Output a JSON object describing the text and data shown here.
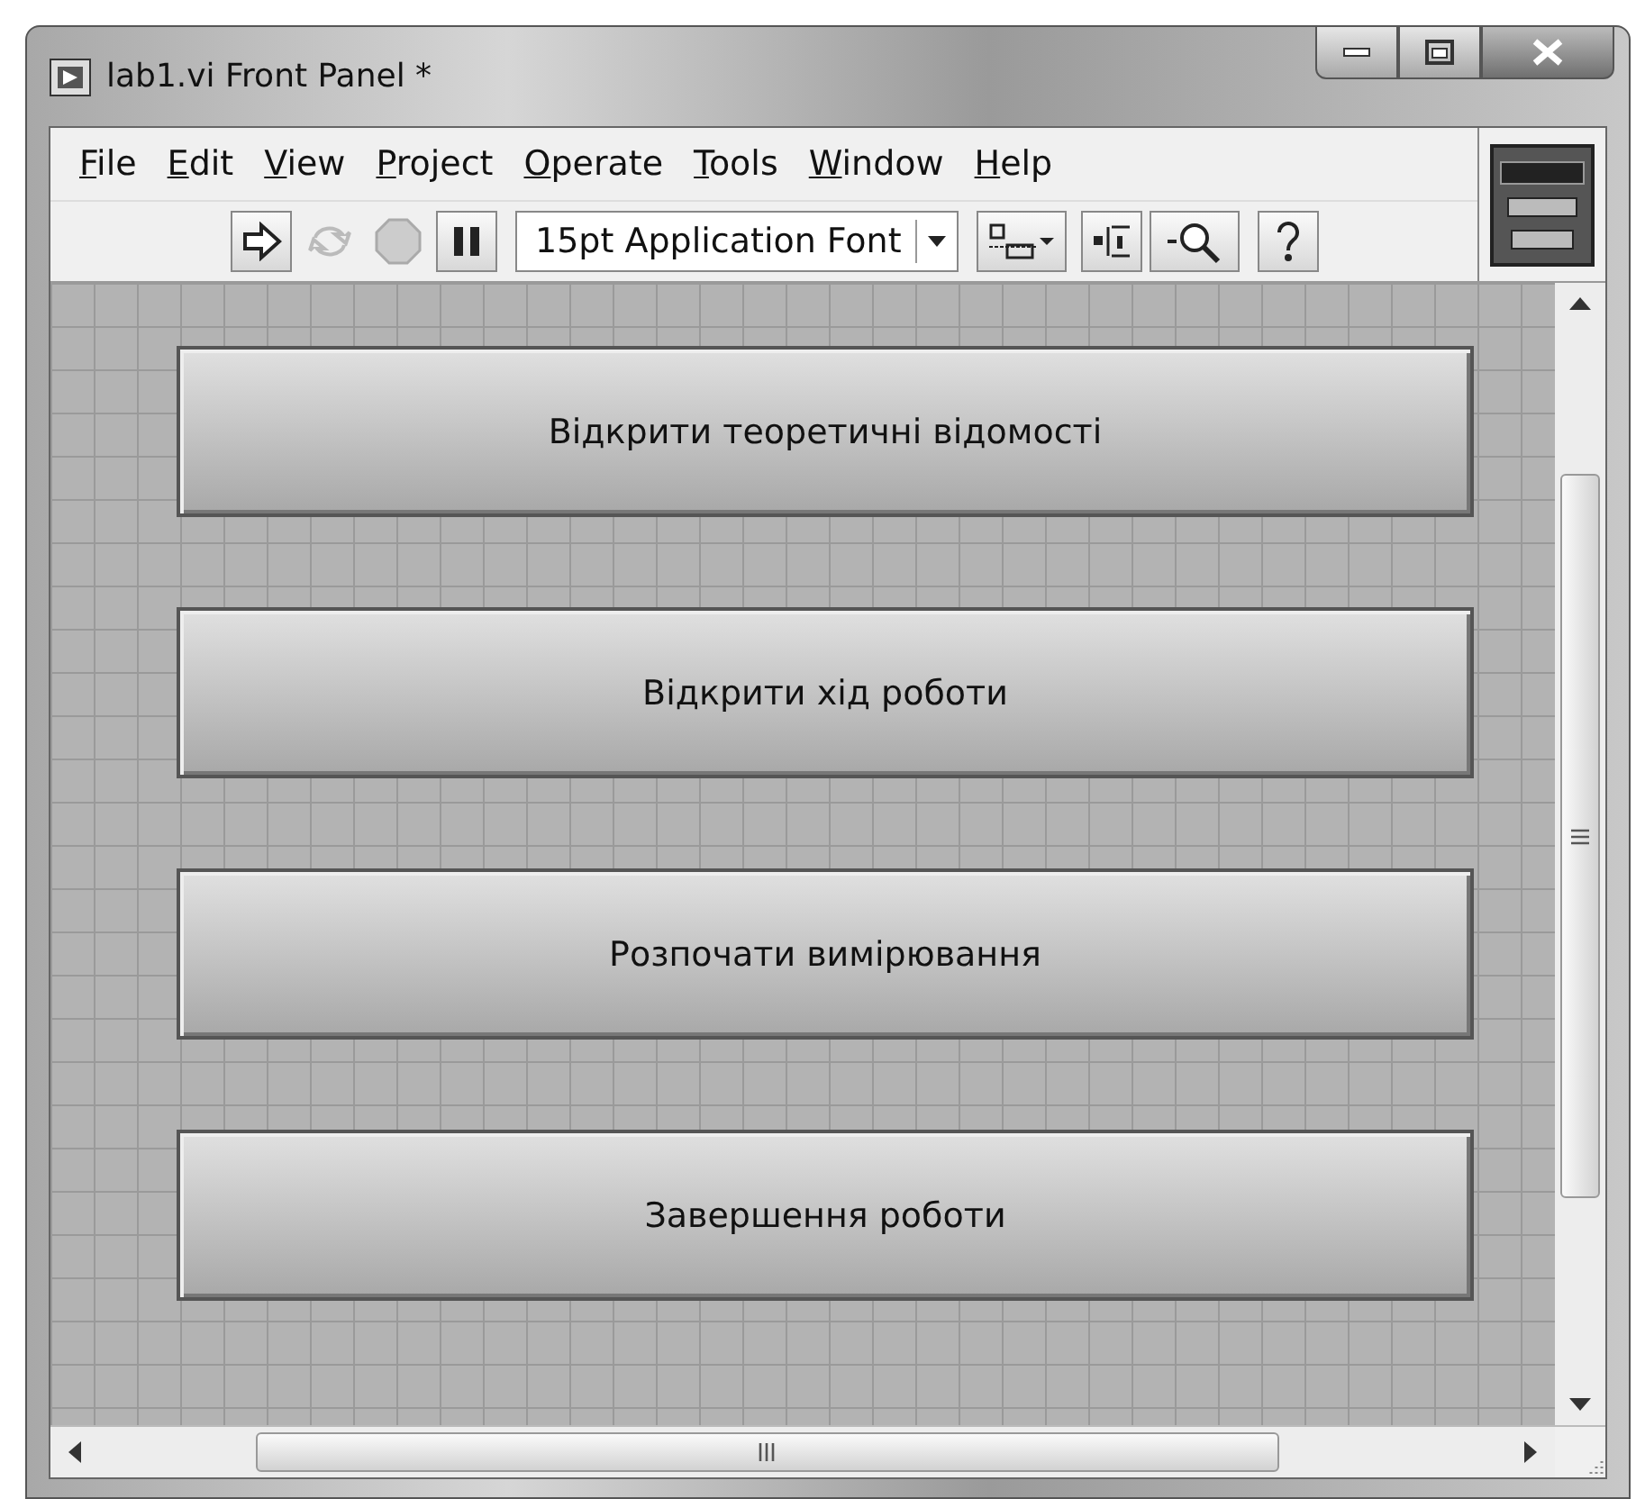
{
  "window": {
    "title": "lab1.vi Front Panel *"
  },
  "menu": [
    "File",
    "Edit",
    "View",
    "Project",
    "Operate",
    "Tools",
    "Window",
    "Help"
  ],
  "toolbar": [
    {
      "kind": "run",
      "disabled": false
    },
    {
      "kind": "run-continuously",
      "disabled": true
    },
    {
      "kind": "abort",
      "disabled": true
    },
    {
      "kind": "pause",
      "disabled": false
    },
    {
      "kind": "font",
      "label": "15pt Application Font",
      "disabled": false
    },
    {
      "kind": "align",
      "disabled": false
    },
    {
      "kind": "resize",
      "disabled": false
    },
    {
      "kind": "zoom",
      "disabled": false
    },
    {
      "kind": "help",
      "disabled": false
    }
  ],
  "panel": {
    "buttons": [
      "Відкрити теоретичні відомості",
      "Відкрити хід роботи",
      "Розпочати вимірювання",
      "Завершення роботи"
    ]
  }
}
